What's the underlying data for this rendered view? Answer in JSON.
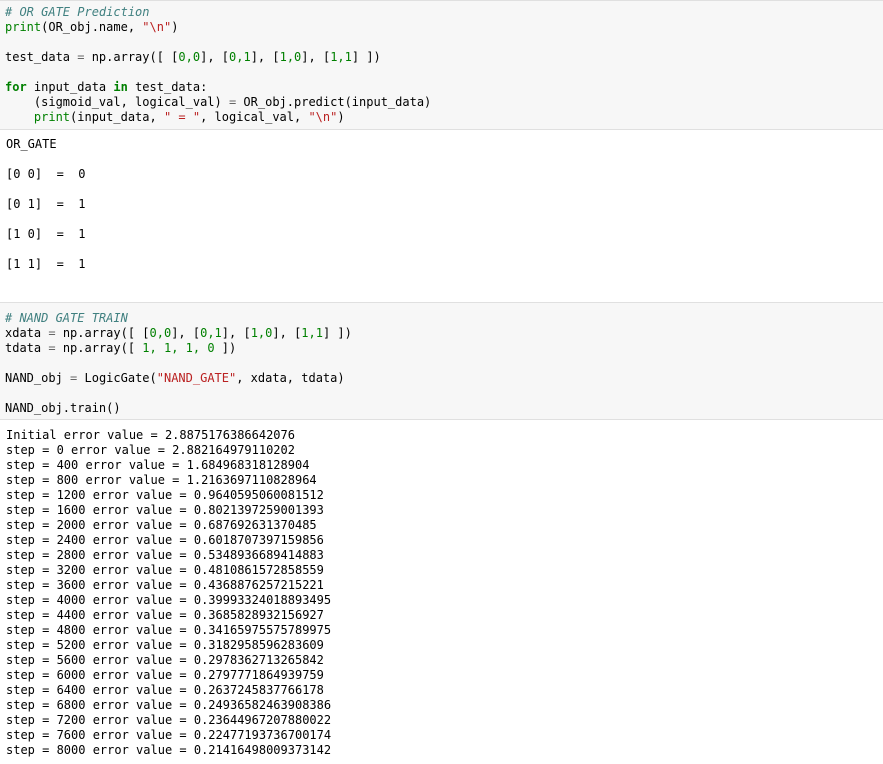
{
  "cell1": {
    "comment": "# OR GATE Prediction",
    "print_kw": "print",
    "print_args_a": "(OR_obj.name, ",
    "print_str": "\"\\n\"",
    "print_args_b": ")",
    "testdata_a": "test_data ",
    "eq": "=",
    "testdata_b": " np.array([ [",
    "testdata_nums": "0,0",
    "testdata_c": "], [",
    "testdata_nums2": "0,1",
    "testdata_d": "], [",
    "testdata_nums3": "1,0",
    "testdata_e": "], [",
    "testdata_nums4": "1,1",
    "testdata_f": "] ])",
    "for_kw": "for",
    "for_var": " input_data ",
    "in_kw": "in",
    "for_rest": " test_data:",
    "predict_a": "    (sigmoid_val, logical_val) ",
    "predict_eq": "=",
    "predict_b": " OR_obj.predict(input_data)",
    "print2_indent": "    ",
    "print2_kw": "print",
    "print2_a": "(input_data, ",
    "print2_str1": "\" = \"",
    "print2_b": ", logical_val, ",
    "print2_str2": "\"\\n\"",
    "print2_c": ")"
  },
  "output1": {
    "lines": [
      "OR_GATE",
      "[0 0]  =  0",
      "[0 1]  =  1",
      "[1 0]  =  1",
      "[1 1]  =  1"
    ]
  },
  "cell2": {
    "comment": "# NAND GATE TRAIN",
    "xdata_a": "xdata ",
    "eq": "=",
    "xdata_b": " np.array([ [",
    "x1": "0,0",
    "xs1": "], [",
    "x2": "0,1",
    "xs2": "], [",
    "x3": "1,0",
    "xs3": "], [",
    "x4": "1,1",
    "xs4": "] ])",
    "tdata_a": "tdata ",
    "tdata_b": " np.array([ ",
    "tnums": "1, 1, 1, 0",
    "tdata_c": " ])",
    "nand_a": "NAND_obj ",
    "nand_b": " LogicGate(",
    "nand_str": "\"NAND_GATE\"",
    "nand_c": ", xdata, tdata)",
    "train": "NAND_obj.train()"
  },
  "output2": {
    "lines": [
      "Initial error value = 2.8875176386642076",
      "step = 0 error value = 2.882164979110202",
      "step = 400 error value = 1.684968318128904",
      "step = 800 error value = 1.2163697110828964",
      "step = 1200 error value = 0.9640595060081512",
      "step = 1600 error value = 0.8021397259001393",
      "step = 2000 error value = 0.687692631370485",
      "step = 2400 error value = 0.6018707397159856",
      "step = 2800 error value = 0.5348936689414883",
      "step = 3200 error value = 0.4810861572858559",
      "step = 3600 error value = 0.4368876257215221",
      "step = 4000 error value = 0.39993324018893495",
      "step = 4400 error value = 0.3685828932156927",
      "step = 4800 error value = 0.34165975575789975",
      "step = 5200 error value = 0.3182958596283609",
      "step = 5600 error value = 0.2978362713265842",
      "step = 6000 error value = 0.2797771864939759",
      "step = 6400 error value = 0.2637245837766178",
      "step = 6800 error value = 0.24936582463908386",
      "step = 7200 error value = 0.23644967207880022",
      "step = 7600 error value = 0.22477193736700174",
      "step = 8000 error value = 0.21416498009373142"
    ]
  },
  "colors": {
    "cell_bg": "#f7f7f7",
    "comment": "#408080",
    "keyword": "#008000",
    "string": "#ba2121",
    "number": "#008000"
  }
}
